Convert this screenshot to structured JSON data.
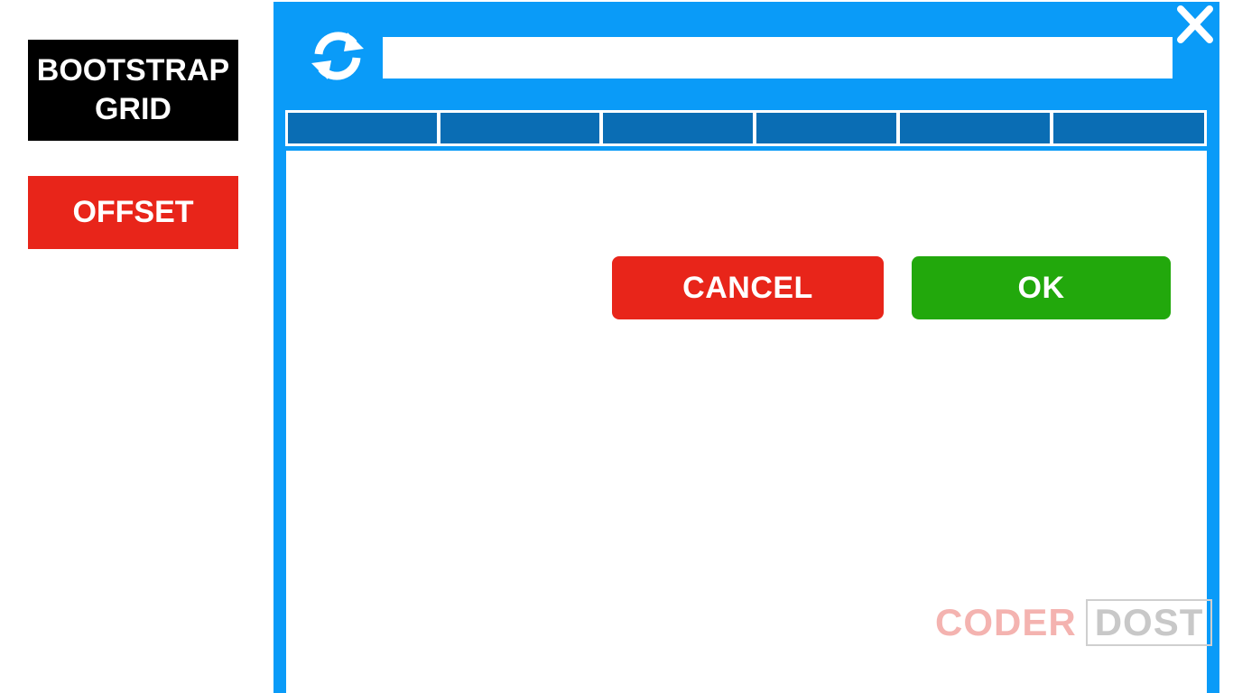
{
  "sidebar": {
    "title_line1": "BOOTSTRAP",
    "title_line2": "GRID",
    "topic_label": "OFFSET"
  },
  "window": {
    "address_value": "",
    "tabs": [
      "",
      "",
      "",
      "",
      "",
      ""
    ],
    "refresh_icon": "refresh-icon",
    "close_icon": "close-icon"
  },
  "dialog": {
    "cancel_label": "CANCEL",
    "ok_label": "OK"
  },
  "watermark": {
    "part1": "CODER",
    "part2": "DOST"
  },
  "colors": {
    "window_blue": "#0a9bf8",
    "tab_blue": "#0a6db4",
    "cancel_red": "#e8251a",
    "ok_green": "#22a80c",
    "title_black": "#000000"
  }
}
